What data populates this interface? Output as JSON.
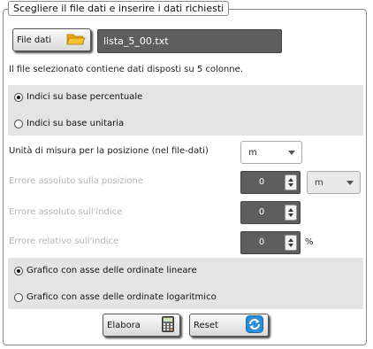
{
  "panel": {
    "legend": "Scegliere il file dati e inserire i dati richiesti"
  },
  "file": {
    "button_label": "File dati",
    "button_icon": "folder-icon",
    "filename": "lista_5_00.txt",
    "info": "Il file selezionato contiene dati disposti su 5 colonne."
  },
  "index_mode": {
    "options": [
      "Indici su base percentuale",
      "Indici su base unitaria"
    ],
    "selected": "Indici su base percentuale"
  },
  "position_unit": {
    "label": "Unità di misura per la posizione (nel file-dati)",
    "value": "m"
  },
  "abs_pos_error": {
    "label": "Errore assoluto sulla posizione",
    "value": "0",
    "unit": "m"
  },
  "abs_idx_error": {
    "label": "Errore assoluto sull'indice",
    "value": "0"
  },
  "rel_idx_error": {
    "label": "Errore relativo sull'indice",
    "value": "0",
    "unit": "%"
  },
  "axis_mode": {
    "options": [
      "Grafico con asse delle ordinate lineare",
      "Grafico con asse delle ordinate logaritmico"
    ],
    "selected": "Grafico con asse delle ordinate lineare"
  },
  "actions": {
    "process_label": "Elabora",
    "process_icon": "calculator-icon",
    "reset_label": "Reset",
    "reset_icon": "refresh-icon"
  },
  "colors": {
    "refresh_blue": "#2a8fd8",
    "folder_yellow": "#f2b21f",
    "dark_field": "#5e5e5e",
    "band_gray": "#e4e4e4"
  }
}
